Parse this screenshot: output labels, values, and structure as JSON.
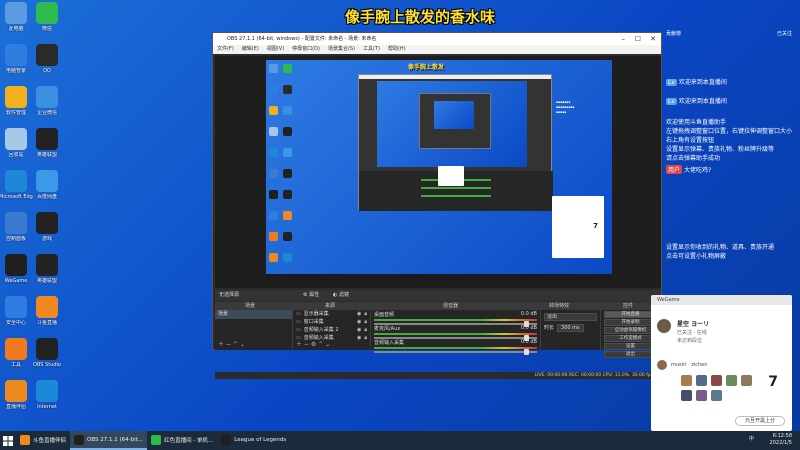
{
  "banner": "像手腕上散发的香水味",
  "desktop_icons": [
    {
      "label": "此电脑",
      "color": "#5b9be0"
    },
    {
      "label": "微信",
      "color": "#2dbb4e"
    },
    {
      "label": "电脑管家",
      "color": "#2d7ee0"
    },
    {
      "label": "QQ",
      "color": "#2a2a2a"
    },
    {
      "label": "软件管理",
      "color": "#f0b020"
    },
    {
      "label": "企业微信",
      "color": "#3b8fe0"
    },
    {
      "label": "回收站",
      "color": "#a8c8e8"
    },
    {
      "label": "英雄联盟",
      "color": "#222222"
    },
    {
      "label": "Microsoft Edge",
      "color": "#1e88d8"
    },
    {
      "label": "百度网盘",
      "color": "#3a9ae8"
    },
    {
      "label": "控制面板",
      "color": "#3a7bd0"
    },
    {
      "label": "游戏",
      "color": "#222222"
    },
    {
      "label": "WeGame",
      "color": "#1f1f1f"
    },
    {
      "label": "英雄联盟",
      "color": "#222222"
    },
    {
      "label": "安全中心",
      "color": "#2d7ee0"
    },
    {
      "label": "斗鱼直播",
      "color": "#f08a20"
    },
    {
      "label": "工具",
      "color": "#f07a20"
    },
    {
      "label": "OBS Studio",
      "color": "#222222"
    },
    {
      "label": "直播伴侣",
      "color": "#f08a20"
    },
    {
      "label": "Internet",
      "color": "#1e88d8"
    }
  ],
  "obs": {
    "title": "OBS 27.1.1 (64-bit, windows) - 配置文件: 未命名 - 场景: 未命名",
    "menu": [
      "文件(F)",
      "编辑(E)",
      "视图(V)",
      "停靠窗口(D)",
      "场景集合(S)",
      "工具(T)",
      "帮助(H)"
    ],
    "preview_banner": "像手腕上散发",
    "scene_bar_text": "无选择源",
    "properties_label": "属性",
    "filters_label": "滤镜",
    "dock_titles": {
      "scenes": "场景",
      "sources": "来源",
      "mixer": "混音器",
      "transitions": "转场特效",
      "controls": "控件"
    },
    "scenes": [
      "场景"
    ],
    "sources": [
      "显示器采集",
      "窗口采集",
      "音频输入采集 2",
      "音频输入采集"
    ],
    "mixer": [
      {
        "name": "桌面音频",
        "db": "0.0 dB"
      },
      {
        "name": "麦克风/Aux",
        "db": "0.0 dB"
      },
      {
        "name": "音频输入采集",
        "db": "0.0 dB"
      }
    ],
    "transition": {
      "type": "淡出",
      "duration_label": "时长",
      "duration": "300 ms"
    },
    "controls": [
      "开始直播",
      "开始录制",
      "启动虚拟摄像机",
      "工作室模式",
      "设置",
      "退出"
    ],
    "status": "LIVE: 00:00:00    REC: 00:00:00    CPU: 11.0%, 30.00 fps"
  },
  "chat": {
    "header_label": "贡献榜",
    "side_label": "已关注",
    "lines": [
      {
        "tag": "Lv",
        "text": "欢迎来到本直播间"
      },
      {
        "tag": "Lv",
        "text": "欢迎来到本直播间"
      },
      {
        "tag": "",
        "text": "欢迎使用斗鱼直播助手"
      },
      {
        "tag": "",
        "text": "左键拖拽调整窗口位置，右键拉伸调整窗口大小"
      },
      {
        "tag": "",
        "text": "右上角有设置按钮"
      },
      {
        "tag": "",
        "text": "设置显示弹幕、贵族礼物、粉丝牌升级等"
      },
      {
        "tag": "",
        "text": "请点击弹幕助手成功"
      },
      {
        "tag": "用户",
        "text": "大佬吃鸡?"
      },
      {
        "tag": "",
        "text": "设置显示你收到的礼物、道具、贵族开通"
      },
      {
        "tag": "",
        "text": "点击可设置小礼物屏蔽"
      }
    ]
  },
  "popup": {
    "header": "WeGame",
    "name": "星空 ヨーリ",
    "sub1": "已关注 · 在线",
    "sub2": "未达到段位",
    "friend_label": "musiri · zichen",
    "count": "7",
    "button_label": "元旦开黑上分"
  },
  "taskbar": {
    "items": [
      {
        "label": "斗鱼直播伴侣",
        "color": "#f08a20",
        "active": false
      },
      {
        "label": "OBS 27.1.1 (64-bit...",
        "color": "#222222",
        "active": true
      },
      {
        "label": "红色直播间 - 单机...",
        "color": "#2dbb4e",
        "active": false
      },
      {
        "label": "League of Legends",
        "color": "#1f1f1f",
        "active": false
      }
    ],
    "time": "6:12:58",
    "date": "2022/1/5",
    "ime": "中"
  }
}
